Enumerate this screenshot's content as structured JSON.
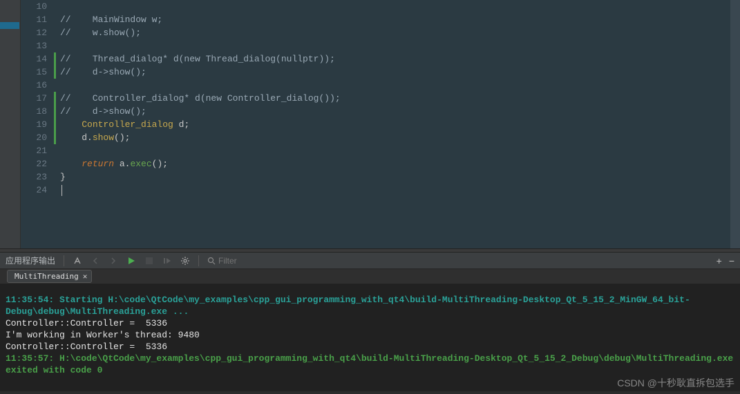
{
  "editor": {
    "lines": [
      {
        "num": "10",
        "mark": "none",
        "segs": []
      },
      {
        "num": "11",
        "mark": "none",
        "segs": [
          {
            "c": "comment",
            "t": "//    MainWindow w;"
          }
        ]
      },
      {
        "num": "12",
        "mark": "none",
        "segs": [
          {
            "c": "comment",
            "t": "//    w.show();"
          }
        ]
      },
      {
        "num": "13",
        "mark": "none",
        "segs": []
      },
      {
        "num": "14",
        "mark": "green",
        "segs": [
          {
            "c": "comment",
            "t": "//    Thread_dialog* d(new Thread_dialog(nullptr));"
          }
        ]
      },
      {
        "num": "15",
        "mark": "green",
        "segs": [
          {
            "c": "comment",
            "t": "//    d->show();"
          }
        ]
      },
      {
        "num": "16",
        "mark": "none",
        "segs": []
      },
      {
        "num": "17",
        "mark": "green",
        "segs": [
          {
            "c": "comment",
            "t": "//    Controller_dialog* d(new Controller_dialog());"
          }
        ]
      },
      {
        "num": "18",
        "mark": "green",
        "segs": [
          {
            "c": "comment",
            "t": "//    d->show();"
          }
        ]
      },
      {
        "num": "19",
        "mark": "green",
        "segs": [
          {
            "c": "plain",
            "t": "    "
          },
          {
            "c": "type",
            "t": "Controller_dialog"
          },
          {
            "c": "plain",
            "t": " d;"
          }
        ]
      },
      {
        "num": "20",
        "mark": "green",
        "segs": [
          {
            "c": "plain",
            "t": "    d."
          },
          {
            "c": "func",
            "t": "show"
          },
          {
            "c": "plain",
            "t": "();"
          }
        ]
      },
      {
        "num": "21",
        "mark": "none",
        "segs": []
      },
      {
        "num": "22",
        "mark": "none",
        "segs": [
          {
            "c": "plain",
            "t": "    "
          },
          {
            "c": "kw",
            "t": "return"
          },
          {
            "c": "plain",
            "t": " a."
          },
          {
            "c": "green-call",
            "t": "exec"
          },
          {
            "c": "plain",
            "t": "();"
          }
        ]
      },
      {
        "num": "23",
        "mark": "none",
        "segs": [
          {
            "c": "plain",
            "t": "}"
          }
        ]
      },
      {
        "num": "24",
        "mark": "none",
        "segs": [],
        "cursor": true
      }
    ]
  },
  "outputPanel": {
    "title": "应用程序输出",
    "filterPlaceholder": "Filter",
    "tabName": "MultiThreading",
    "plus": "+",
    "minus": "−"
  },
  "console": {
    "lines": [
      {
        "c": "out-blue",
        "t": "11:35:54: Starting H:\\code\\QtCode\\my_examples\\cpp_gui_programming_with_qt4\\build-MultiThreading-Desktop_Qt_5_15_2_MinGW_64_bit-Debug\\debug\\MultiThreading.exe ..."
      },
      {
        "c": "out-white",
        "t": "Controller::Controller =  5336"
      },
      {
        "c": "out-white",
        "t": "I'm working in Worker's thread: 9480"
      },
      {
        "c": "out-white",
        "t": "Controller::Controller =  5336"
      },
      {
        "c": "out-green",
        "t": "11:35:57: H:\\code\\QtCode\\my_examples\\cpp_gui_programming_with_qt4\\build-MultiThreading-Desktop_Qt_5_15_2_Debug\\debug\\MultiThreading.exe exited with code 0"
      }
    ]
  },
  "watermark": "CSDN @十秒耿直拆包选手"
}
